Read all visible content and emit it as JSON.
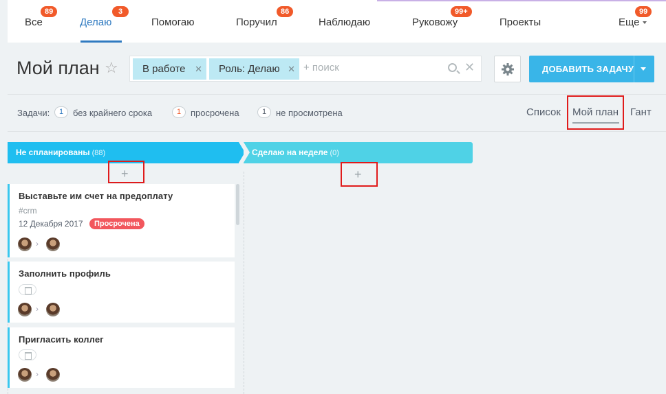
{
  "nav": {
    "items": [
      {
        "label": "Все",
        "badge": "89"
      },
      {
        "label": "Делаю",
        "badge": "3"
      },
      {
        "label": "Помогаю",
        "badge": ""
      },
      {
        "label": "Поручил",
        "badge": "86"
      },
      {
        "label": "Наблюдаю",
        "badge": ""
      },
      {
        "label": "Руковожу",
        "badge": "99+"
      },
      {
        "label": "Проекты",
        "badge": ""
      },
      {
        "label": "Еще",
        "badge": "99"
      }
    ],
    "active": "Делаю"
  },
  "header": {
    "title": "Мой план",
    "filters": [
      {
        "label": "В работе"
      },
      {
        "label": "Роль: Делаю"
      }
    ],
    "search_placeholder": "+ поиск",
    "add_task_label": "ДОБАВИТЬ ЗАДАЧУ"
  },
  "counters": {
    "label": "Задачи:",
    "items": [
      {
        "count": "1",
        "label": "без крайнего срока"
      },
      {
        "count": "1",
        "label": "просрочена",
        "color": "#f15a2a"
      },
      {
        "count": "1",
        "label": "не просмотрена"
      }
    ]
  },
  "views": {
    "tabs": [
      "Список",
      "Мой план",
      "Гант"
    ],
    "active": "Мой план"
  },
  "columns": [
    {
      "title": "Не спланированы",
      "count": "(88)",
      "color": "#1fbef0"
    },
    {
      "title": "Сделаю на неделе",
      "count": "(0)",
      "color": "#4fd2e6"
    }
  ],
  "add_symbol": "+",
  "cards": [
    {
      "title": "Выставьте им счет на предоплату",
      "tag": "#crm",
      "date": "12 Декабря 2017",
      "status": "Просрочена"
    },
    {
      "title": "Заполнить профиль",
      "tag": "",
      "date": "",
      "status": ""
    },
    {
      "title": "Пригласить коллег",
      "tag": "",
      "date": "",
      "status": ""
    }
  ],
  "colors": {
    "accent": "#2f7ac0",
    "button": "#39b5e8",
    "badge": "#f15a2a",
    "overdue": "#f2575d",
    "highlight": "#e01b1b"
  }
}
